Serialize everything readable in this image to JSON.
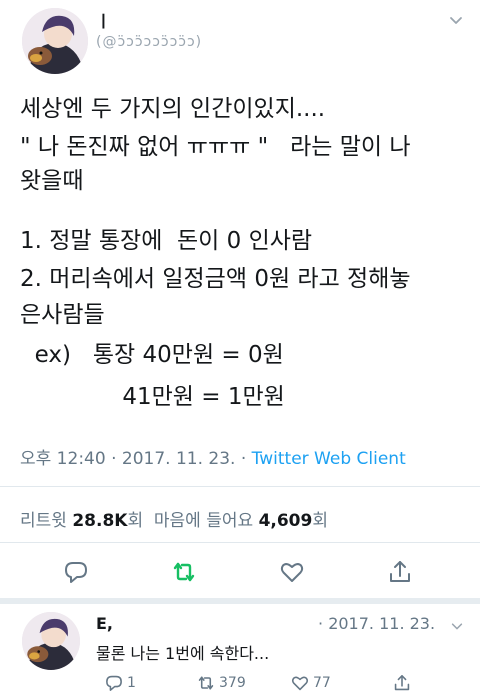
{
  "tweet": {
    "name": "ㅣ",
    "handle": "(@ɔ̈ɔɔ̈ɔɔɔ̈ɔɔ̈ɔ)",
    "lines": [
      "세상엔 두 가지의 인간이있지....",
      "\" 나 돈진짜 없어 ㅠㅠㅠ \"   라는 말이 나",
      "왓을때",
      "1. 정말 통장에  돈이 0 인사람",
      "2. 머리속에서 일정금액 0원 라고 정해놓",
      "은사람들",
      "  ex)   통장 40만원 = 0원",
      "              41만원 = 1만원"
    ],
    "time": "오후 12:40",
    "date": "2017. 11. 23.",
    "separator": "·",
    "client": "Twitter Web Client"
  },
  "stats": {
    "retweets_label": "리트윗",
    "retweets_count": "28.8K",
    "retweets_unit": "회",
    "likes_label": "마음에 들어요",
    "likes_count": "4,609",
    "likes_unit": "회"
  },
  "actions": {
    "reply_icon": "reply-icon",
    "retweet_icon": "retweet-icon",
    "like_icon": "heart-icon",
    "share_icon": "share-icon",
    "retweet_color": "#17bf63"
  },
  "reply": {
    "name": "E,",
    "separator": "·",
    "date": "2017. 11. 23.",
    "text": "물론 나는 1번에 속한다...",
    "reply_count": "1",
    "retweet_count": "379",
    "like_count": "77"
  }
}
